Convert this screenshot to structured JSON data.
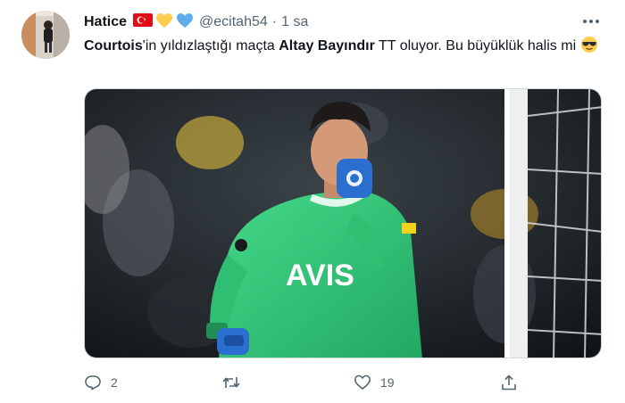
{
  "tweet": {
    "author": {
      "name": "Hatice",
      "handle": "@ecitah54",
      "separator": "·",
      "time": "1 sa",
      "badges": [
        "turkey-flag-icon",
        "yellow-heart-icon",
        "blue-heart-icon"
      ]
    },
    "text": {
      "part1_bold": "Courtois",
      "part2": "'in yıldızlaştığı maçta ",
      "part3_bold": "Altay Bayındır",
      "part4": " TT oluyor. Bu büyüklük halis mi "
    },
    "media": {
      "jersey_sponsor": "AVIS",
      "jersey_color": "#35c97a"
    },
    "actions": {
      "reply_count": "2",
      "retweet_count": "",
      "like_count": "19"
    }
  },
  "colors": {
    "text_primary": "#0f1419",
    "text_secondary": "#536471",
    "border": "#cfd9de"
  }
}
